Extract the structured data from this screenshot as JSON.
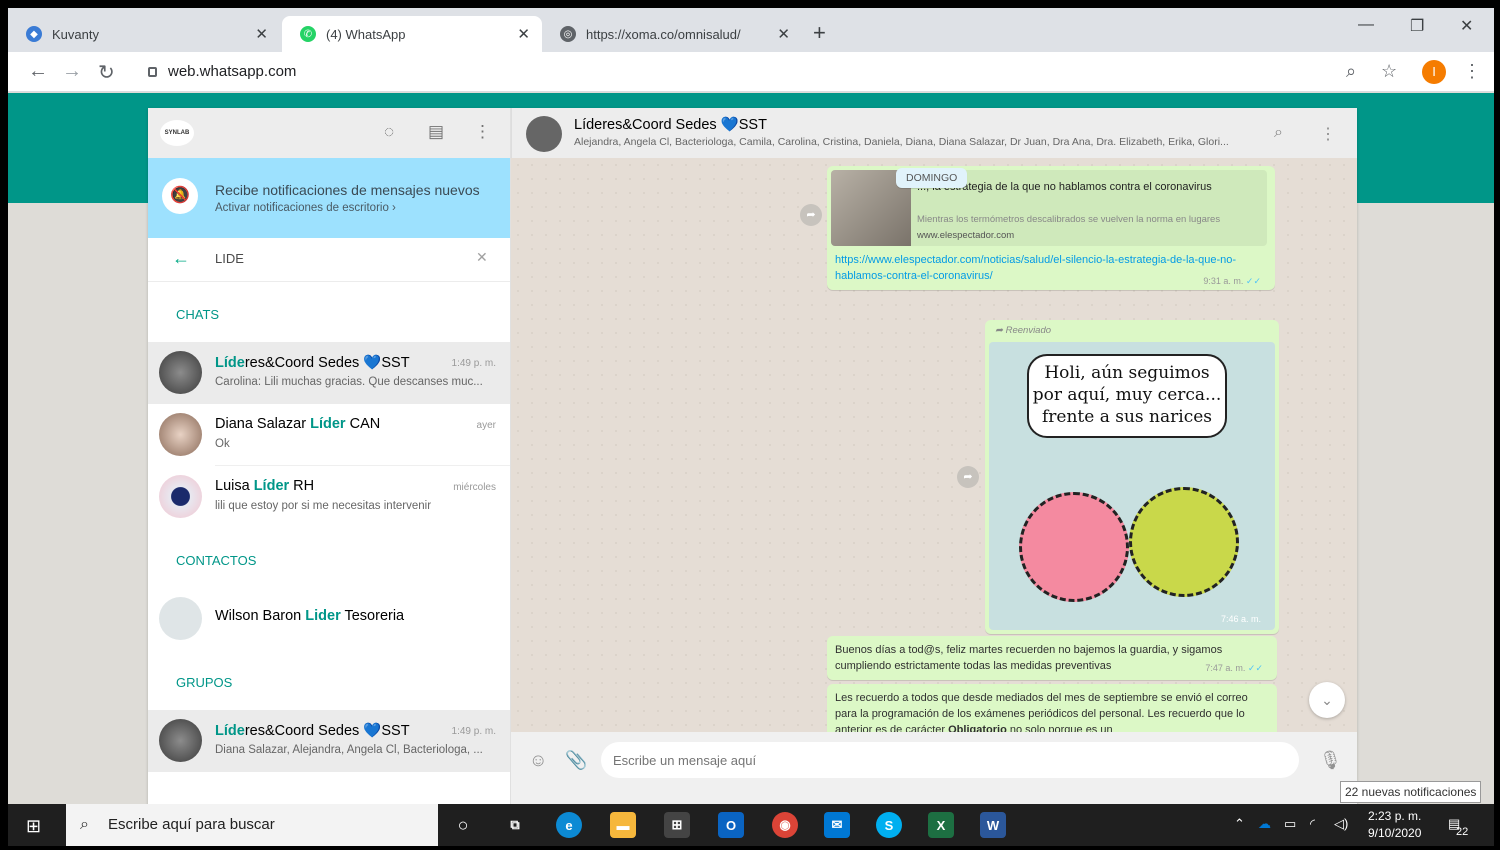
{
  "browser": {
    "tabs": [
      {
        "title": "Kuvanty"
      },
      {
        "title": "(4) WhatsApp"
      },
      {
        "title": "https://xoma.co/omnisalud/"
      }
    ],
    "url": "web.whatsapp.com",
    "profile_initial": "I"
  },
  "sidebar": {
    "logo_text": "SYNLAB",
    "notification": {
      "title": "Recibe notificaciones de mensajes nuevos",
      "subtitle": "Activar notificaciones de escritorio ›"
    },
    "search_value": "LIDE",
    "sections": {
      "chats": "CHATS",
      "contacts": "CONTACTOS",
      "groups": "GRUPOS"
    },
    "chats": [
      {
        "name_hl": "Líde",
        "name_rest": "res&Coord Sedes ",
        "emoji": "💙",
        "name_tail": "SST",
        "time": "1:49 p. m.",
        "preview": "Carolina: Lili muchas gracias. Que descanses muc..."
      },
      {
        "name_pre": "Diana Salazar ",
        "name_hl": "Líder",
        "name_rest": " CAN",
        "time": "ayer",
        "preview": "Ok"
      },
      {
        "name_pre": "Luisa ",
        "name_hl": "Líder",
        "name_rest": " RH",
        "time": "miércoles",
        "preview": "lili que estoy por si me necesitas intervenir"
      }
    ],
    "contacts": [
      {
        "name_pre": "Wilson Baron ",
        "name_hl": "Lider",
        "name_rest": " Tesoreria"
      }
    ],
    "groups": [
      {
        "name_hl": "Líde",
        "name_rest": "res&Coord Sedes ",
        "emoji": "💙",
        "name_tail": "SST",
        "time": "1:49 p. m.",
        "preview": "Diana Salazar, Alejandra, Angela Cl, Bacteriologa, ..."
      }
    ]
  },
  "conversation": {
    "title": "Líderes&Coord Sedes 💙SST",
    "members": "Alejandra, Angela Cl, Bacteriologa, Camila, Carolina, Cristina, Daniela, Diana, Diana Salazar, Dr Juan, Dra Ana, Dra. Elizabeth, Erika, Glori...",
    "date_chip": "DOMINGO",
    "link_message": {
      "title": "..., la estrategia de la que no hablamos contra el coronavirus",
      "description": "Mientras los termómetros descalibrados se vuelven la norma en lugares",
      "domain": "www.elespectador.com",
      "url": "https://www.elespectador.com/noticias/salud/el-silencio-la-estrategia-de-la-que-no-hablamos-contra-el-coronavirus/",
      "time": "9:31 a. m."
    },
    "image_message": {
      "forwarded_label": "Reenviado",
      "speech_text": "Holi, aún seguimos por aquí, muy cerca... frente a sus narices",
      "time": "7:46 a. m."
    },
    "text_message_1": {
      "text": "Buenos días a tod@s, feliz martes recuerden no bajemos la guardia, y sigamos cumpliendo estrictamente todas las medidas preventivas",
      "time": "7:47 a. m."
    },
    "text_message_2": {
      "text_before": "Les recuerdo a todos que desde mediados del mes de septiembre se envió el correo para la programación de los exámenes periódicos del personal. Les recuerdo que lo anterior es de carácter ",
      "bold": "Obligatorio",
      "text_after": " no solo porque es un"
    },
    "input_placeholder": "Escribe un mensaje aquí"
  },
  "taskbar": {
    "search_placeholder": "Escribe aquí para buscar",
    "time": "2:23 p. m.",
    "date": "9/10/2020",
    "notification_count": "22",
    "toast": "22 nuevas notificaciones"
  },
  "colors": {
    "whatsapp_teal": "#009688",
    "bubble_green": "#dcf8c6",
    "notif_blue": "#9de1fe"
  }
}
